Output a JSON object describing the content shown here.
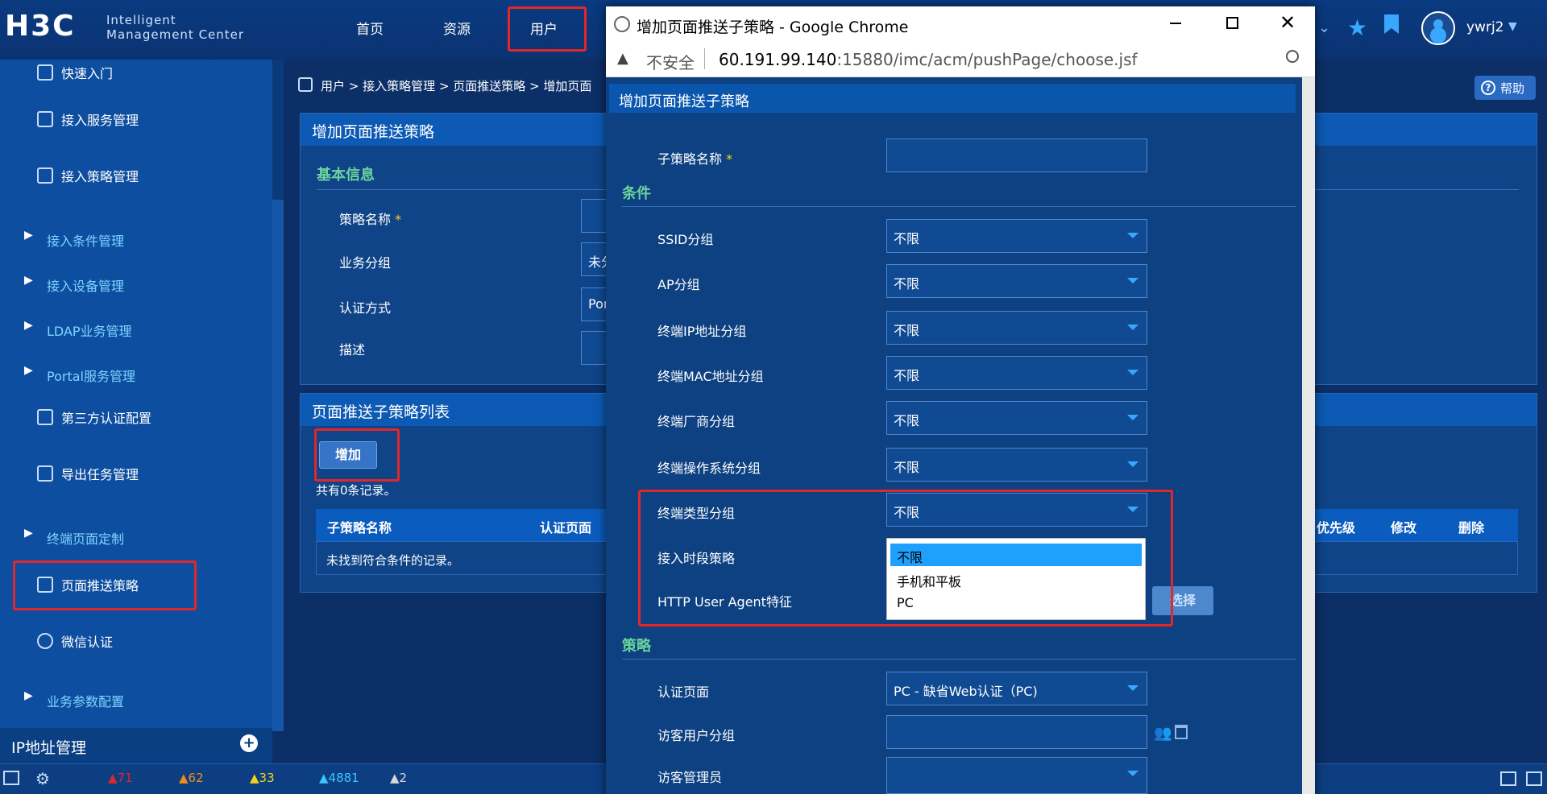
{
  "topbar": {
    "logo": "H3C",
    "subtitle_line1": "Intelligent",
    "subtitle_line2": "Management Center",
    "tabs": [
      "首页",
      "资源",
      "用户"
    ],
    "username": "ywrj2"
  },
  "sidebar": {
    "items": [
      {
        "label": "快速入门",
        "type": "item"
      },
      {
        "label": "接入服务管理",
        "type": "item"
      },
      {
        "label": "接入策略管理",
        "type": "item"
      },
      {
        "label": "接入条件管理",
        "type": "group"
      },
      {
        "label": "接入设备管理",
        "type": "group"
      },
      {
        "label": "LDAP业务管理",
        "type": "group"
      },
      {
        "label": "Portal服务管理",
        "type": "group"
      },
      {
        "label": "第三方认证配置",
        "type": "item"
      },
      {
        "label": "导出任务管理",
        "type": "item"
      },
      {
        "label": "终端页面定制",
        "type": "group"
      },
      {
        "label": "页面推送策略",
        "type": "item"
      },
      {
        "label": "微信认证",
        "type": "item"
      },
      {
        "label": "业务参数配置",
        "type": "group"
      }
    ],
    "ip_section": "IP地址管理"
  },
  "breadcrumb": "用户 > 接入策略管理 > 页面推送策略 > 增加页面",
  "help": "帮助",
  "main_panel": {
    "title": "增加页面推送策略",
    "section": "基本信息",
    "fields": [
      {
        "label": "策略名称",
        "required": "*",
        "value": ""
      },
      {
        "label": "业务分组",
        "value": "未分"
      },
      {
        "label": "认证方式",
        "value": "Por"
      },
      {
        "label": "描述",
        "value": ""
      }
    ]
  },
  "list_panel": {
    "title": "页面推送子策略列表",
    "add_button": "增加",
    "count_text": "共有0条记录。",
    "columns_left": [
      "子策略名称",
      "认证页面"
    ],
    "columns_right": [
      "优先级",
      "修改",
      "删除"
    ],
    "empty_text": "未找到符合条件的记录。"
  },
  "bottombar": {
    "alarms": [
      {
        "count": "71",
        "color": "#e3262a"
      },
      {
        "count": "62",
        "color": "#f08c1e"
      },
      {
        "count": "33",
        "color": "#f5d21a"
      },
      {
        "count": "4881",
        "color": "#3ac6ff"
      },
      {
        "count": "2",
        "color": "#d9d9d9"
      }
    ]
  },
  "chrome": {
    "window_title": "增加页面推送子策略 - Google Chrome",
    "insecure_label": "不安全",
    "url_host": "60.191.99.140",
    "url_rest": ":15880/imc/acm/pushPage/choose.jsf"
  },
  "dialog": {
    "title": "增加页面推送子策略",
    "name_label": "子策略名称",
    "required": "*",
    "conditions_title": "条件",
    "conditions": [
      {
        "label": "SSID分组",
        "value": "不限"
      },
      {
        "label": "AP分组",
        "value": "不限"
      },
      {
        "label": "终端IP地址分组",
        "value": "不限"
      },
      {
        "label": "终端MAC地址分组",
        "value": "不限"
      },
      {
        "label": "终端厂商分组",
        "value": "不限"
      },
      {
        "label": "终端操作系统分组",
        "value": "不限"
      },
      {
        "label": "终端类型分组",
        "value": "不限"
      }
    ],
    "time_policy_label": "接入时段策略",
    "ua_label": "HTTP User Agent特征",
    "choose_button": "选择",
    "dropdown_options": [
      "不限",
      "手机和平板",
      "PC"
    ],
    "policy_title": "策略",
    "auth_page_label": "认证页面",
    "auth_page_value": "PC - 缺省Web认证（PC)",
    "guest_group_label": "访客用户分组",
    "guest_admin_label": "访客管理员"
  }
}
